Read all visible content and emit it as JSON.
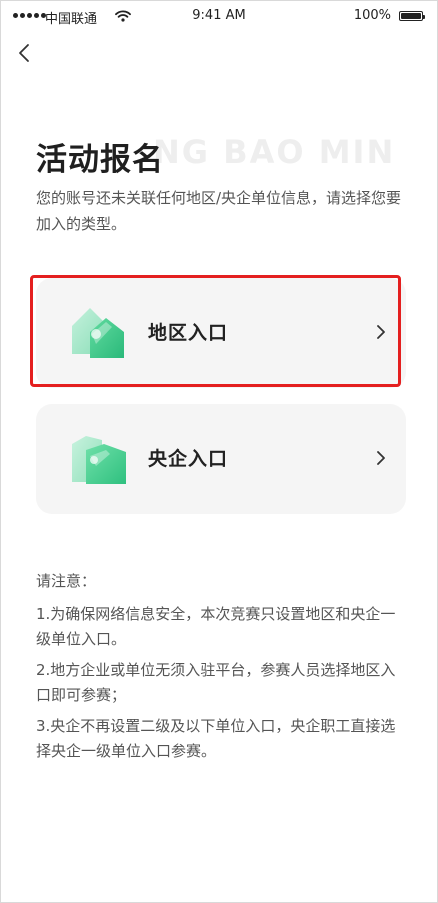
{
  "status_bar": {
    "carrier": "中国联通",
    "time": "9:41 AM",
    "battery": "100%"
  },
  "nav": {
    "back_icon": "chevron-left-icon"
  },
  "header": {
    "title": "活动报名",
    "bg_text": "NG BAO MING",
    "subtitle": "您的账号还未关联任何地区/央企单位信息，请选择您要加入的类型。"
  },
  "cards": [
    {
      "label": "地区入口",
      "icon": "house-icon",
      "highlighted": true
    },
    {
      "label": "央企入口",
      "icon": "building-icon",
      "highlighted": false
    }
  ],
  "notes": {
    "title": "请注意：",
    "items": [
      "1.为确保网络信息安全，本次竞赛只设置地区和央企一级单位入口。",
      "2.地方企业或单位无须入驻平台，参赛人员选择地区入口即可参赛；",
      "3.央企不再设置二级及以下单位入口，央企职工直接选择央企一级单位入口参赛。"
    ]
  },
  "colors": {
    "accent_green": "#3cc98a",
    "highlight_red": "#e41f1f",
    "card_bg": "#f5f5f5"
  }
}
